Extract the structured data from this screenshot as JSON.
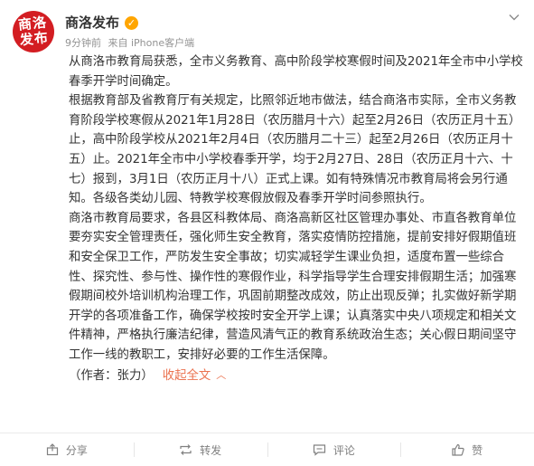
{
  "post": {
    "author": "商洛发布",
    "avatar_text": "商洛发布",
    "time": "9分钟前",
    "source": "来自 iPhone客户端",
    "paragraphs": [
      "从商洛市教育局获悉，全市义务教育、高中阶段学校寒假时间及2021年全市中小学校春季开学时间确定。",
      "根据教育部及省教育厅有关规定，比照邻近地市做法，结合商洛市实际，全市义务教育阶段学校寒假从2021年1月28日（农历腊月十六）起至2月26日（农历正月十五）止，高中阶段学校从2021年2月4日（农历腊月二十三）起至2月26日（农历正月十五）止。2021年全市中小学校春季开学，均于2月27日、28日（农历正月十六、十七）报到，3月1日（农历正月十八）正式上课。如有特殊情况市教育局将会另行通知。各级各类幼儿园、特教学校寒假放假及春季开学时间参照执行。",
      "商洛市教育局要求，各县区科教体局、商洛高新区社区管理办事处、市直各教育单位要夯实安全管理责任，强化师生安全教育，落实疫情防控措施，提前安排好假期值班和安全保卫工作，严防发生安全事故；切实减轻学生课业负担，适度布置一些综合性、探究性、参与性、操作性的寒假作业，科学指导学生合理安排假期生活；加强寒假期间校外培训机构治理工作，巩固前期整改成效，防止出现反弹；扎实做好新学期开学的各项准备工作，确保学校按时安全开学上课；认真落实中央八项规定和相关文件精神，严格执行廉洁纪律，营造风清气正的教育系统政治生态；关心假日期间坚守工作一线的教职工，安排好必要的工作生活保障。"
    ],
    "byline": "（作者：张力）",
    "collapse_label": "收起全文"
  },
  "actions": {
    "share": "分享",
    "repost": "转发",
    "comment": "评论",
    "like": "赞"
  },
  "colors": {
    "avatar_bg": "#d31d22",
    "verified_badge": "#ffa500",
    "link": "#eb7350",
    "meta_text": "#939393"
  },
  "icons": {
    "verified": "verified-badge-icon",
    "more": "chevron-down-icon",
    "collapse": "chevron-up-icon",
    "share": "share-icon",
    "repost": "repost-icon",
    "comment": "comment-icon",
    "like": "thumbs-up-icon"
  }
}
